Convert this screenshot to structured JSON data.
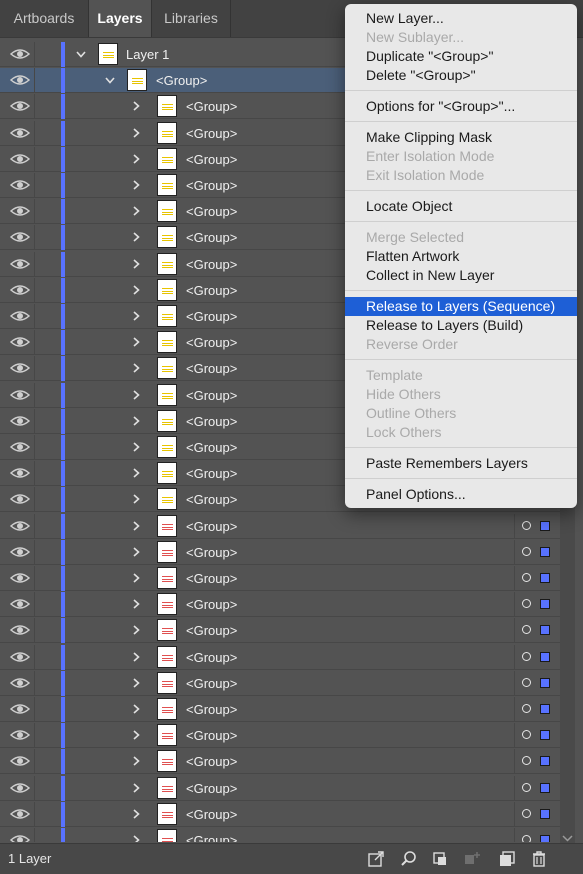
{
  "tabs": [
    {
      "label": "Artboards",
      "active": false
    },
    {
      "label": "Layers",
      "active": true
    },
    {
      "label": "Libraries",
      "active": false
    }
  ],
  "layers": {
    "top_layer": {
      "label": "Layer 1",
      "color": "#5872ff"
    },
    "selected_group": {
      "label": "<Group>"
    },
    "rows": [
      {
        "label": "<Group>",
        "thumb": "yellow",
        "indicators": false
      },
      {
        "label": "<Group>",
        "thumb": "yellow",
        "indicators": false
      },
      {
        "label": "<Group>",
        "thumb": "yellow",
        "indicators": false
      },
      {
        "label": "<Group>",
        "thumb": "yellow",
        "indicators": false
      },
      {
        "label": "<Group>",
        "thumb": "yellow",
        "indicators": false
      },
      {
        "label": "<Group>",
        "thumb": "yellow",
        "indicators": false
      },
      {
        "label": "<Group>",
        "thumb": "yellow",
        "indicators": false
      },
      {
        "label": "<Group>",
        "thumb": "yellow",
        "indicators": false
      },
      {
        "label": "<Group>",
        "thumb": "yellow",
        "indicators": false
      },
      {
        "label": "<Group>",
        "thumb": "yellow",
        "indicators": false
      },
      {
        "label": "<Group>",
        "thumb": "yellow",
        "indicators": false
      },
      {
        "label": "<Group>",
        "thumb": "yellow",
        "indicators": false
      },
      {
        "label": "<Group>",
        "thumb": "yellow",
        "indicators": false
      },
      {
        "label": "<Group>",
        "thumb": "yellow",
        "indicators": false
      },
      {
        "label": "<Group>",
        "thumb": "yellow",
        "indicators": false
      },
      {
        "label": "<Group>",
        "thumb": "yellow",
        "indicators": false
      },
      {
        "label": "<Group>",
        "thumb": "red",
        "indicators": true
      },
      {
        "label": "<Group>",
        "thumb": "red",
        "indicators": true
      },
      {
        "label": "<Group>",
        "thumb": "red",
        "indicators": true
      },
      {
        "label": "<Group>",
        "thumb": "red",
        "indicators": true
      },
      {
        "label": "<Group>",
        "thumb": "red",
        "indicators": true
      },
      {
        "label": "<Group>",
        "thumb": "red",
        "indicators": true
      },
      {
        "label": "<Group>",
        "thumb": "red",
        "indicators": true
      },
      {
        "label": "<Group>",
        "thumb": "red",
        "indicators": true
      },
      {
        "label": "<Group>",
        "thumb": "red",
        "indicators": true
      },
      {
        "label": "<Group>",
        "thumb": "red",
        "indicators": true
      },
      {
        "label": "<Group>",
        "thumb": "red",
        "indicators": true
      },
      {
        "label": "<Group>",
        "thumb": "red",
        "indicators": true
      },
      {
        "label": "<Group>",
        "thumb": "red",
        "indicators": true
      }
    ]
  },
  "menu": {
    "sections": [
      [
        {
          "label": "New Layer...",
          "enabled": true
        },
        {
          "label": "New Sublayer...",
          "enabled": false
        },
        {
          "label": "Duplicate \"<Group>\"",
          "enabled": true
        },
        {
          "label": "Delete \"<Group>\"",
          "enabled": true
        }
      ],
      [
        {
          "label": "Options for \"<Group>\"...",
          "enabled": true
        }
      ],
      [
        {
          "label": "Make Clipping Mask",
          "enabled": true
        },
        {
          "label": "Enter Isolation Mode",
          "enabled": false
        },
        {
          "label": "Exit Isolation Mode",
          "enabled": false
        }
      ],
      [
        {
          "label": "Locate Object",
          "enabled": true
        }
      ],
      [
        {
          "label": "Merge Selected",
          "enabled": false
        },
        {
          "label": "Flatten Artwork",
          "enabled": true
        },
        {
          "label": "Collect in New Layer",
          "enabled": true
        }
      ],
      [
        {
          "label": "Release to Layers (Sequence)",
          "enabled": true,
          "highlighted": true
        },
        {
          "label": "Release to Layers (Build)",
          "enabled": true
        },
        {
          "label": "Reverse Order",
          "enabled": false
        }
      ],
      [
        {
          "label": "Template",
          "enabled": false
        },
        {
          "label": "Hide Others",
          "enabled": false
        },
        {
          "label": "Outline Others",
          "enabled": false
        },
        {
          "label": "Lock Others",
          "enabled": false
        }
      ],
      [
        {
          "label": "Paste Remembers Layers",
          "enabled": true
        }
      ],
      [
        {
          "label": "Panel Options...",
          "enabled": true
        }
      ]
    ]
  },
  "status": {
    "layer_count": "1 Layer",
    "icons": [
      "export-icon",
      "search-icon",
      "clipping-mask-icon",
      "sublayer-icon",
      "new-layer-icon",
      "trash-icon"
    ]
  },
  "colors": {
    "layer_color": "#5872ff",
    "highlight": "#1e5fd6",
    "thumb_yellow": "#e8c400",
    "thumb_red": "#e05050"
  }
}
